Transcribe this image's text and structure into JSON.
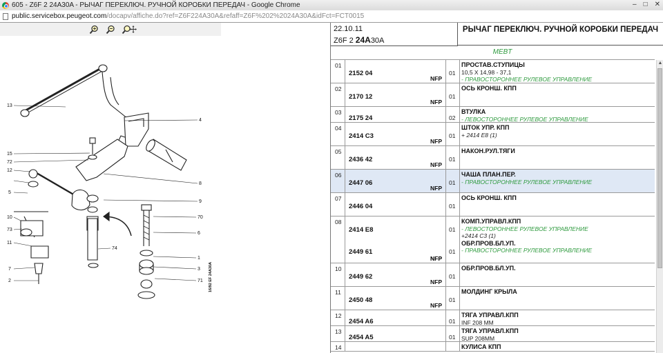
{
  "window": {
    "title": "605 - Z6F 2 24A30A - РЫЧАГ ПЕРЕКЛЮЧ. РУЧНОЙ КОРОБКИ ПЕРЕДАЧ - Google Chrome",
    "controls": [
      "–",
      "□",
      "✕"
    ]
  },
  "address": {
    "host": "public.servicebox.peugeot.com",
    "path": "/docapv/affiche.do?ref=Z6F224A30A&refaff=Z6F%202%2024A30A&idFct=FCT0015"
  },
  "zoom": {
    "icons": [
      "zoom-in-icon",
      "zoom-out-icon",
      "zoom-pan-icon"
    ]
  },
  "diagram": {
    "callouts": [
      "13",
      "4",
      "15",
      "72",
      "12",
      "8",
      "5",
      "9",
      "73",
      "10",
      "11",
      "6",
      "7",
      "2",
      "70",
      "74",
      "1",
      "3",
      "71"
    ],
    "stamp": "16/92 ΕF 24A30A"
  },
  "header": {
    "date": "22.10.11",
    "code_prefix": "Z6F 2",
    "code_bold": "24A",
    "code_suffix": "30A",
    "title": "РЫЧАГ ПЕРЕКЛЮЧ. РУЧНОЙ КОРОБКИ ПЕРЕДАЧ",
    "subtitle": "MEBT"
  },
  "rows": [
    {
      "idx": "01",
      "ref": "2152 04",
      "nfp": "NFP",
      "qty": "01",
      "name": "ПРОСТАВ.СТУПИЦЫ",
      "dim": "10,5 X 14,98 - 37,1",
      "green": "- ПРАВОСТОРОННЕЕ РУЛЕВОЕ УПРАВЛЕНИЕ",
      "note": ""
    },
    {
      "idx": "02",
      "ref": "2170 12",
      "nfp": "NFP",
      "qty": "01",
      "name": "ОСЬ КРОНШ. КПП",
      "dim": "",
      "green": "",
      "note": ""
    },
    {
      "idx": "03",
      "ref": "2175 24",
      "nfp": "",
      "qty": "02",
      "name": "ВТУЛКА",
      "dim": "",
      "green": "- ЛЕВОСТОРОННЕЕ РУЛЕВОЕ УПРАВЛЕНИЕ",
      "note": ""
    },
    {
      "idx": "04",
      "ref": "2414 C3",
      "nfp": "NFP",
      "qty": "01",
      "name": "ШТОК УПР. КПП",
      "dim": "",
      "green": "",
      "note": "+ 2414 E8 (1)"
    },
    {
      "idx": "05",
      "ref": "2436 42",
      "nfp": "NFP",
      "qty": "01",
      "name": "НАКОН.РУЛ.ТЯГИ",
      "dim": "",
      "green": "",
      "note": ""
    },
    {
      "idx": "06",
      "ref": "2447 06",
      "nfp": "NFP",
      "qty": "01",
      "name": "ЧАША ПЛАН.ПЕР.",
      "dim": "",
      "green": "- ПРАВОСТОРОННЕЕ РУЛЕВОЕ УПРАВЛЕНИЕ",
      "note": ""
    },
    {
      "idx": "07",
      "ref": "2446 04",
      "nfp": "",
      "qty": "01",
      "name": "ОСЬ КРОНШ. КПП",
      "dim": "",
      "green": "",
      "note": ""
    },
    {
      "idx": "08",
      "ref": "2414 E8",
      "nfp": "NFP",
      "qty": "01",
      "name": "КОМП.УПРАВЛ.КПП",
      "dim": "",
      "green": "- ЛЕВОСТОРОННЕЕ РУЛЕВОЕ УПРАВЛЕНИЕ",
      "note": "+2414 C3 (1)",
      "ref2": "2449 61",
      "nfp2": "NFP",
      "qty2": "01",
      "name2": "ОБР.ПРОВ.БЛ.УП.",
      "green2": "- ПРАВОСТОРОННЕЕ РУЛЕВОЕ УПРАВЛЕНИЕ"
    },
    {
      "idx": "10",
      "ref": "2449 62",
      "nfp": "NFP",
      "qty": "01",
      "name": "ОБР.ПРОВ.БЛ.УП.",
      "dim": "",
      "green": "",
      "note": ""
    },
    {
      "idx": "11",
      "ref": "2450 48",
      "nfp": "NFP",
      "qty": "01",
      "name": "МОЛДИНГ КРЫЛА",
      "dim": "",
      "green": "",
      "note": ""
    },
    {
      "idx": "12",
      "ref": "2454 A6",
      "nfp": "",
      "qty": "01",
      "name": "ТЯГА УПРАВЛ.КПП",
      "dim": "INF 208 MM",
      "green": "",
      "note": ""
    },
    {
      "idx": "13",
      "ref": "2454 A5",
      "nfp": "",
      "qty": "01",
      "name": "ТЯГА УПРАВЛ.КПП",
      "dim": "SUP 208MM",
      "green": "",
      "note": ""
    },
    {
      "idx": "14",
      "ref": "",
      "nfp": "",
      "qty": "",
      "name": "КУЛИСА КПП",
      "dim": "",
      "green": "",
      "note": ""
    }
  ],
  "colors": {
    "selected_row": "#dfe8f5",
    "green_text": "#2e9a3e"
  }
}
